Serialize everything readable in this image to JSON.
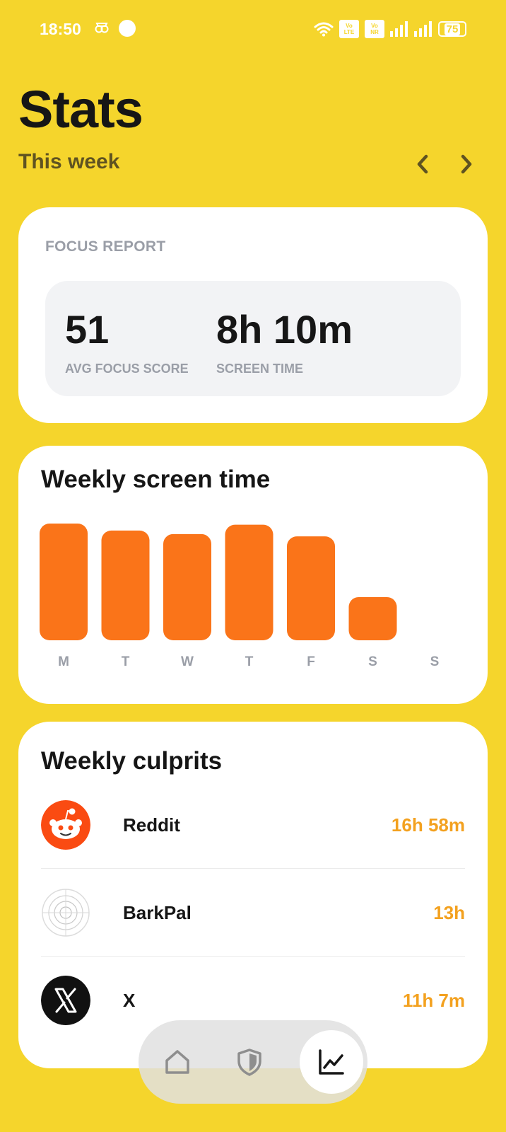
{
  "status_bar": {
    "time": "18:50",
    "battery": "75",
    "sim1": "Vo LTE",
    "sim2": "Vo NR",
    "icons": [
      "recording-icon",
      "dot-icon",
      "wifi-icon",
      "signal-icon",
      "signal-icon",
      "battery-icon"
    ]
  },
  "header": {
    "title": "Stats",
    "period": "This week",
    "prev_icon": "chevron-left-icon",
    "next_icon": "chevron-right-icon"
  },
  "focus_report": {
    "eyebrow": "FOCUS REPORT",
    "avg_focus_score": {
      "value": "51",
      "label": "AVG FOCUS SCORE"
    },
    "screen_time": {
      "value": "8h 10m",
      "label": "SCREEN TIME"
    }
  },
  "weekly_screen_time": {
    "title": "Weekly screen time"
  },
  "chart_data": {
    "type": "bar",
    "title": "Weekly screen time",
    "categories": [
      "M",
      "T",
      "W",
      "T",
      "F",
      "S",
      "S"
    ],
    "values": [
      1.0,
      0.94,
      0.91,
      0.99,
      0.89,
      0.37,
      0
    ],
    "ylim": [
      0,
      1
    ],
    "unit": "relative",
    "grid": false,
    "bar_color": "#fa7419"
  },
  "culprits": {
    "title": "Weekly culprits",
    "items": [
      {
        "name": "Reddit",
        "time": "16h 58m",
        "icon": "reddit-icon"
      },
      {
        "name": "BarkPal",
        "time": "13h",
        "icon": "barkpal-icon"
      },
      {
        "name": "X",
        "time": "11h 7m",
        "icon": "x-icon"
      }
    ]
  },
  "bottom_nav": {
    "items": [
      {
        "icon": "home-icon",
        "active": false
      },
      {
        "icon": "shield-icon",
        "active": false
      },
      {
        "icon": "chart-icon",
        "active": true
      }
    ]
  },
  "colors": {
    "background": "#f5d52c",
    "accent_orange": "#fa7419",
    "time_orange": "#f3a11f"
  }
}
